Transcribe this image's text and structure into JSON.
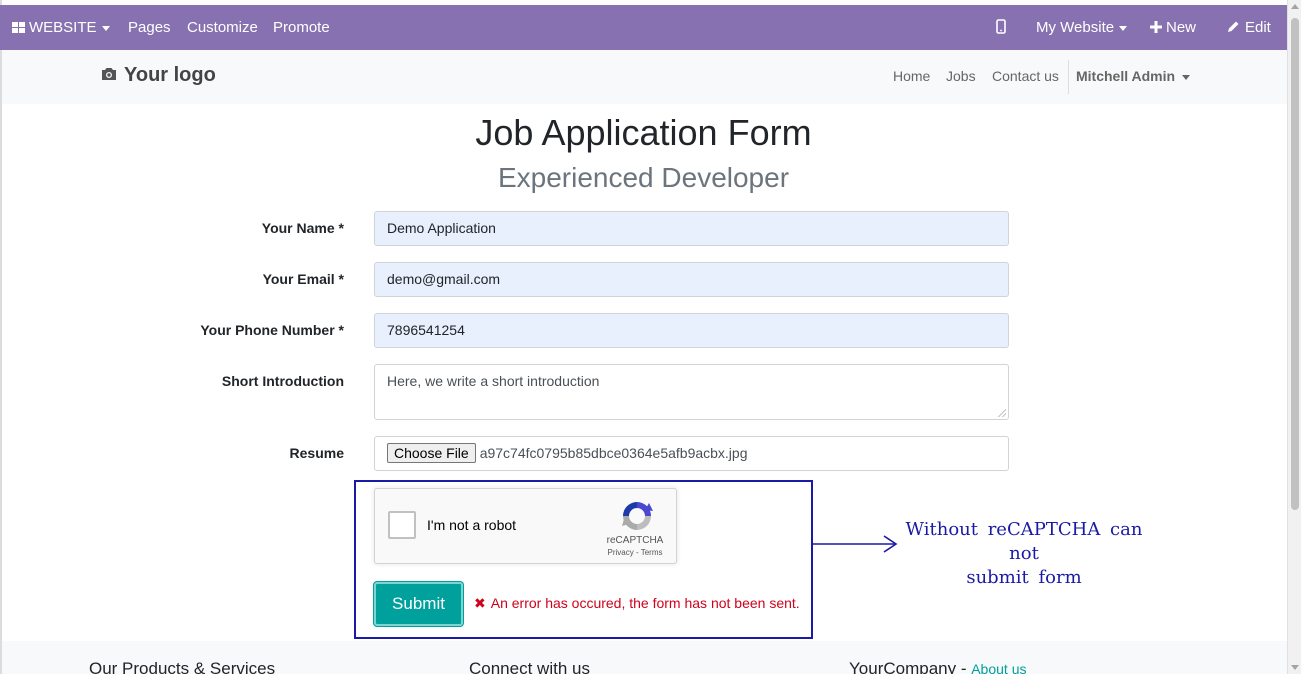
{
  "admin_bar": {
    "apps_label": "WEBSITE",
    "menu": [
      "Pages",
      "Customize",
      "Promote"
    ],
    "site_selector": "My Website",
    "new_label": "New",
    "edit_label": "Edit"
  },
  "header": {
    "logo_text": "Your logo",
    "nav": [
      "Home",
      "Jobs",
      "Contact us"
    ],
    "user": "Mitchell Admin"
  },
  "page": {
    "title": "Job Application Form",
    "subtitle": "Experienced Developer"
  },
  "form": {
    "name_label": "Your Name *",
    "name_value": "Demo Application",
    "email_label": "Your Email *",
    "email_value": "demo@gmail.com",
    "phone_label": "Your Phone Number *",
    "phone_value": "7896541254",
    "intro_label": "Short Introduction",
    "intro_value": "Here, we write a short introduction",
    "resume_label": "Resume",
    "file_button": "Choose File",
    "file_name": "a97c74fc0795b85dbce0364e5afb9acbx.jpg",
    "submit_label": "Submit",
    "error_message": "An error has occured, the form has not been sent."
  },
  "recaptcha": {
    "checkbox_label": "I'm not a robot",
    "brand": "reCAPTCHA",
    "links": "Privacy - Terms"
  },
  "annotation": {
    "line1": "Without reCAPTCHA can not",
    "line2": "submit form"
  },
  "footer": {
    "col1": "Our Products & Services",
    "col2": "Connect with us",
    "col3_company": "YourCompany",
    "col3_sep": " - ",
    "col3_link": "About us"
  },
  "colors": {
    "admin_bar": "#8771b0",
    "accent": "#00a09d",
    "error": "#d0021b",
    "annotation": "#1a1aa6"
  }
}
